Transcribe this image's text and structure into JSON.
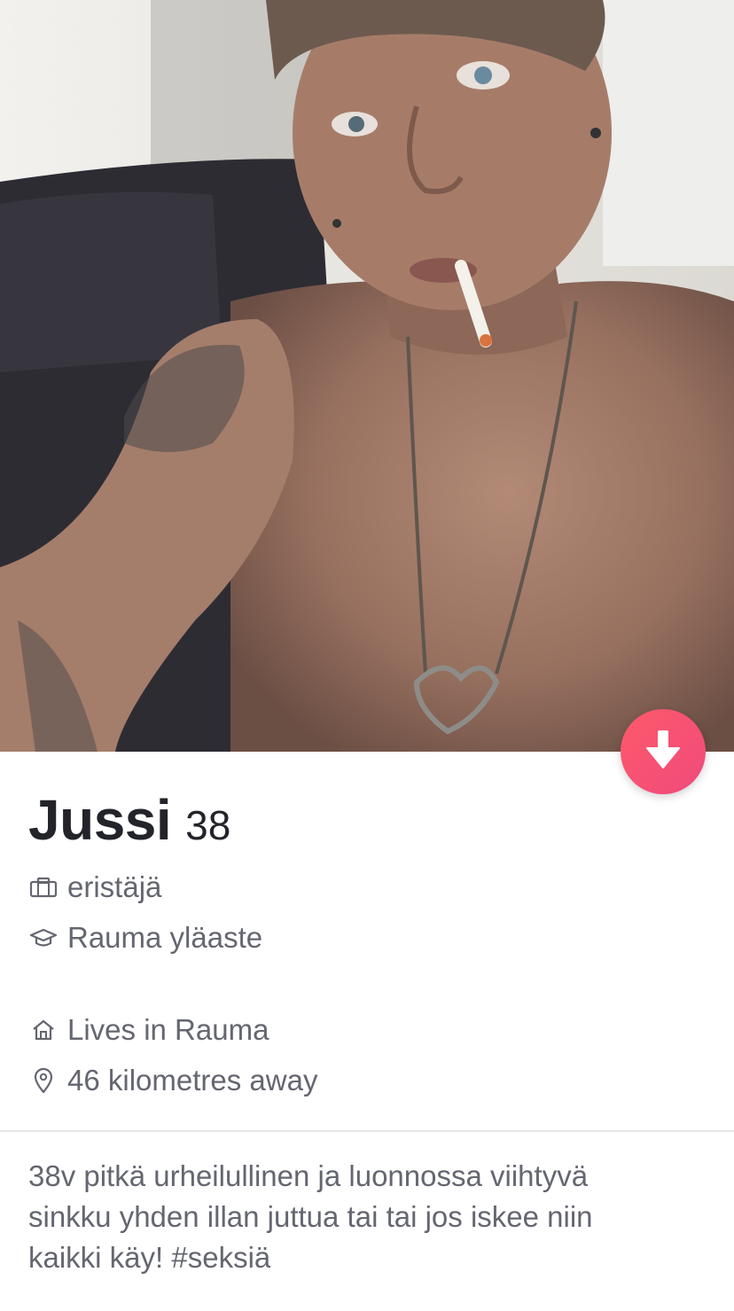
{
  "profile": {
    "name": "Jussi",
    "age": "38",
    "job": "eristäjä",
    "school": "Rauma yläaste",
    "lives_in": "Lives in Rauma",
    "distance": "46 kilometres away",
    "bio": "38v pitkä urheilullinen ja luonnossa viihtyvä\nsinkku yhden illan juttua tai tai jos iskee niin\nkaikki käy! #seksiä"
  },
  "icons": {
    "collapse": "arrow-down-icon",
    "job": "briefcase-icon",
    "school": "graduation-cap-icon",
    "home": "home-icon",
    "location": "location-pin-icon"
  },
  "colors": {
    "accent_start": "#fd5a6a",
    "accent_end": "#f04a7c",
    "name_text": "#22242a",
    "detail_text": "#646670"
  }
}
